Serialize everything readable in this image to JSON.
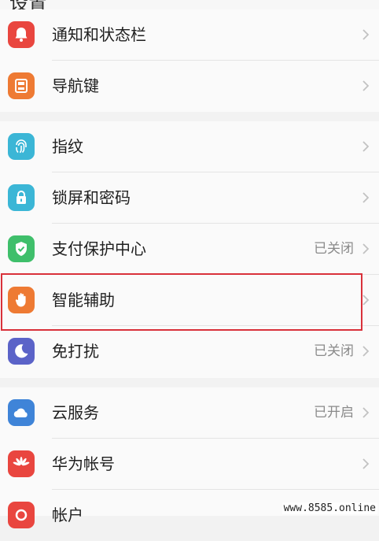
{
  "header": {
    "title": "设置"
  },
  "groups": [
    {
      "items": [
        {
          "label": "通知和状态栏",
          "icon": "bell-icon",
          "color": "#e9463f"
        },
        {
          "label": "导航键",
          "icon": "navigation-key-icon",
          "color": "#ee7a33"
        }
      ]
    },
    {
      "items": [
        {
          "label": "指纹",
          "icon": "fingerprint-icon",
          "color": "#3bb6d6"
        },
        {
          "label": "锁屏和密码",
          "icon": "lock-icon",
          "color": "#3bb6d6"
        },
        {
          "label": "支付保护中心",
          "status": "已关闭",
          "icon": "shield-check-icon",
          "color": "#3fbf6b"
        },
        {
          "label": "智能辅助",
          "icon": "hand-icon",
          "color": "#ee7a33",
          "highlighted": true
        },
        {
          "label": "免打扰",
          "status": "已关闭",
          "icon": "moon-icon",
          "color": "#5b63c8"
        }
      ]
    },
    {
      "items": [
        {
          "label": "云服务",
          "status": "已开启",
          "icon": "cloud-icon",
          "color": "#3f84d8"
        },
        {
          "label": "华为帐号",
          "icon": "huawei-logo-icon",
          "color": "#e9463f"
        },
        {
          "label": "帐户",
          "icon": "account-icon",
          "color": "#e9463f"
        }
      ]
    }
  ],
  "colors": {
    "highlight_border": "#d9313a",
    "chevron": "#c2c2c2"
  },
  "watermark": "www.8585.online"
}
